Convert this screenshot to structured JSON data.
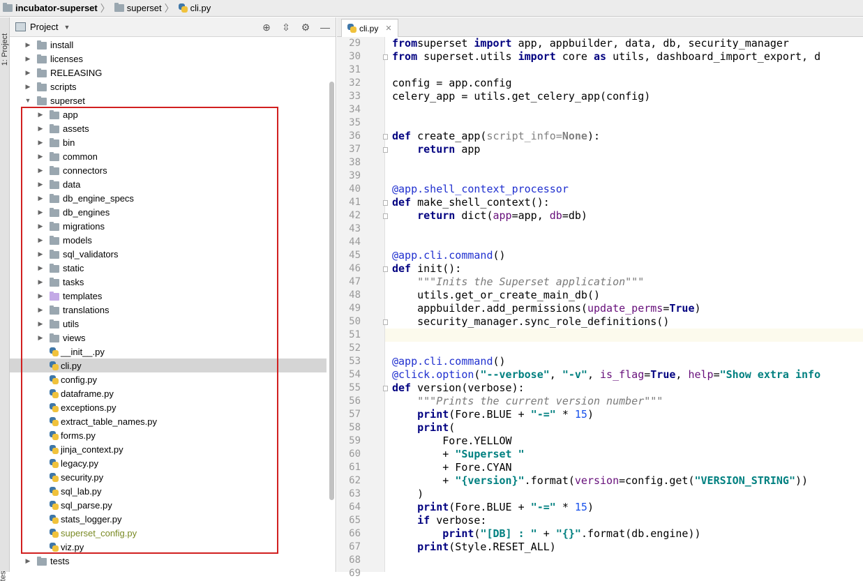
{
  "breadcrumb": {
    "project": "incubator-superset",
    "folder": "superset",
    "file": "cli.py"
  },
  "tool_strip": {
    "project_label": "1: Project",
    "bottom_label": "tes"
  },
  "project_panel": {
    "title": "Project",
    "tree": [
      {
        "label": "install",
        "type": "folder",
        "depth": 0,
        "expanded": false
      },
      {
        "label": "licenses",
        "type": "folder",
        "depth": 0,
        "expanded": false
      },
      {
        "label": "RELEASING",
        "type": "folder",
        "depth": 0,
        "expanded": false
      },
      {
        "label": "scripts",
        "type": "folder",
        "depth": 0,
        "expanded": false
      },
      {
        "label": "superset",
        "type": "folder",
        "depth": 0,
        "expanded": true
      },
      {
        "label": "app",
        "type": "folder",
        "depth": 1,
        "expanded": false
      },
      {
        "label": "assets",
        "type": "folder",
        "depth": 1,
        "expanded": false
      },
      {
        "label": "bin",
        "type": "folder",
        "depth": 1,
        "expanded": false
      },
      {
        "label": "common",
        "type": "folder",
        "depth": 1,
        "expanded": false
      },
      {
        "label": "connectors",
        "type": "folder",
        "depth": 1,
        "expanded": false
      },
      {
        "label": "data",
        "type": "folder",
        "depth": 1,
        "expanded": false
      },
      {
        "label": "db_engine_specs",
        "type": "folder",
        "depth": 1,
        "expanded": false
      },
      {
        "label": "db_engines",
        "type": "folder",
        "depth": 1,
        "expanded": false
      },
      {
        "label": "migrations",
        "type": "folder",
        "depth": 1,
        "expanded": false
      },
      {
        "label": "models",
        "type": "folder",
        "depth": 1,
        "expanded": false
      },
      {
        "label": "sql_validators",
        "type": "folder",
        "depth": 1,
        "expanded": false
      },
      {
        "label": "static",
        "type": "folder",
        "depth": 1,
        "expanded": false
      },
      {
        "label": "tasks",
        "type": "folder",
        "depth": 1,
        "expanded": false
      },
      {
        "label": "templates",
        "type": "folder-purple",
        "depth": 1,
        "expanded": false
      },
      {
        "label": "translations",
        "type": "folder",
        "depth": 1,
        "expanded": false
      },
      {
        "label": "utils",
        "type": "folder",
        "depth": 1,
        "expanded": false
      },
      {
        "label": "views",
        "type": "folder",
        "depth": 1,
        "expanded": false
      },
      {
        "label": "__init__.py",
        "type": "py",
        "depth": 1
      },
      {
        "label": "cli.py",
        "type": "py",
        "depth": 1,
        "selected": true
      },
      {
        "label": "config.py",
        "type": "py",
        "depth": 1
      },
      {
        "label": "dataframe.py",
        "type": "py",
        "depth": 1
      },
      {
        "label": "exceptions.py",
        "type": "py",
        "depth": 1
      },
      {
        "label": "extract_table_names.py",
        "type": "py",
        "depth": 1
      },
      {
        "label": "forms.py",
        "type": "py",
        "depth": 1
      },
      {
        "label": "jinja_context.py",
        "type": "py",
        "depth": 1
      },
      {
        "label": "legacy.py",
        "type": "py",
        "depth": 1
      },
      {
        "label": "security.py",
        "type": "py",
        "depth": 1
      },
      {
        "label": "sql_lab.py",
        "type": "py",
        "depth": 1
      },
      {
        "label": "sql_parse.py",
        "type": "py",
        "depth": 1
      },
      {
        "label": "stats_logger.py",
        "type": "py",
        "depth": 1
      },
      {
        "label": "superset_config.py",
        "type": "py",
        "depth": 1,
        "olive": true
      },
      {
        "label": "viz.py",
        "type": "py",
        "depth": 1
      },
      {
        "label": "tests",
        "type": "folder",
        "depth": 0,
        "expanded": false
      }
    ]
  },
  "editor": {
    "tab_label": "cli.py",
    "current_line": 51,
    "first_line": 29,
    "lines": [
      [
        [
          "kw",
          "from"
        ],
        [
          "",
          "superset"
        ],
        [
          "kw",
          " import"
        ],
        [
          "",
          " app, appbuilder, data, db, security_manager"
        ]
      ],
      [
        [
          "kw",
          "from"
        ],
        [
          "",
          " superset.utils "
        ],
        [
          "kw",
          "import"
        ],
        [
          "",
          " core "
        ],
        [
          "kw",
          "as"
        ],
        [
          "",
          " utils, dashboard_import_export, d"
        ]
      ],
      [],
      [
        [
          "",
          "config = app.config"
        ]
      ],
      [
        [
          "",
          "celery_app = utils.get_celery_app(config)"
        ]
      ],
      [],
      [],
      [
        [
          "kw",
          "def"
        ],
        [
          "",
          " create_app("
        ],
        [
          "gray",
          "script_info="
        ],
        [
          "gray bold",
          "None"
        ],
        [
          "",
          "):"
        ]
      ],
      [
        [
          "",
          "    "
        ],
        [
          "kw",
          "return"
        ],
        [
          "",
          " app"
        ]
      ],
      [],
      [],
      [
        [
          "dec",
          "@app.shell_context_processor"
        ]
      ],
      [
        [
          "kw",
          "def"
        ],
        [
          "",
          " make_shell_context():"
        ]
      ],
      [
        [
          "",
          "    "
        ],
        [
          "kw",
          "return"
        ],
        [
          "",
          " dict("
        ],
        [
          "param",
          "app"
        ],
        [
          "",
          "=app, "
        ],
        [
          "param",
          "db"
        ],
        [
          "",
          "=db)"
        ]
      ],
      [],
      [],
      [
        [
          "dec",
          "@app.cli.command"
        ],
        [
          "",
          "()"
        ]
      ],
      [
        [
          "kw",
          "def"
        ],
        [
          "",
          " init():"
        ]
      ],
      [
        [
          "",
          "    "
        ],
        [
          "doc",
          "\"\"\"Inits the Superset application\"\"\""
        ]
      ],
      [
        [
          "",
          "    utils.get_or_create_main_db()"
        ]
      ],
      [
        [
          "",
          "    appbuilder.add_permissions("
        ],
        [
          "param",
          "update_perms"
        ],
        [
          "",
          "="
        ],
        [
          "kw",
          "True"
        ],
        [
          "",
          ")"
        ]
      ],
      [
        [
          "",
          "    security_manager.sync_role_definitions()"
        ]
      ],
      [],
      [],
      [
        [
          "dec",
          "@app.cli.command"
        ],
        [
          "",
          "()"
        ]
      ],
      [
        [
          "dec",
          "@click.option"
        ],
        [
          "",
          "("
        ],
        [
          "str2",
          "\"--verbose\""
        ],
        [
          "",
          ", "
        ],
        [
          "str2",
          "\"-v\""
        ],
        [
          "",
          ", "
        ],
        [
          "param",
          "is_flag"
        ],
        [
          "",
          "="
        ],
        [
          "kw",
          "True"
        ],
        [
          "",
          ", "
        ],
        [
          "param",
          "help"
        ],
        [
          "",
          "="
        ],
        [
          "str2",
          "\"Show extra info"
        ]
      ],
      [
        [
          "kw",
          "def"
        ],
        [
          "",
          " version(verbose):"
        ]
      ],
      [
        [
          "",
          "    "
        ],
        [
          "doc",
          "\"\"\"Prints the current version number\"\"\""
        ]
      ],
      [
        [
          "",
          "    "
        ],
        [
          "kw",
          "print"
        ],
        [
          "",
          "(Fore.BLUE + "
        ],
        [
          "str2",
          "\"-=\""
        ],
        [
          "",
          " * "
        ],
        [
          "num",
          "15"
        ],
        [
          "",
          ")"
        ]
      ],
      [
        [
          "",
          "    "
        ],
        [
          "kw",
          "print"
        ],
        [
          "",
          "("
        ]
      ],
      [
        [
          "",
          "        Fore.YELLOW"
        ]
      ],
      [
        [
          "",
          "        + "
        ],
        [
          "str2",
          "\"Superset \""
        ]
      ],
      [
        [
          "",
          "        + Fore.CYAN"
        ]
      ],
      [
        [
          "",
          "        + "
        ],
        [
          "str2",
          "\"{version}\""
        ],
        [
          "",
          ".format("
        ],
        [
          "param",
          "version"
        ],
        [
          "",
          "=config.get("
        ],
        [
          "str2",
          "\"VERSION_STRING\""
        ],
        [
          "",
          "))"
        ]
      ],
      [
        [
          "",
          "    )"
        ]
      ],
      [
        [
          "",
          "    "
        ],
        [
          "kw",
          "print"
        ],
        [
          "",
          "(Fore.BLUE + "
        ],
        [
          "str2",
          "\"-=\""
        ],
        [
          "",
          " * "
        ],
        [
          "num",
          "15"
        ],
        [
          "",
          ")"
        ]
      ],
      [
        [
          "",
          "    "
        ],
        [
          "kw",
          "if"
        ],
        [
          "",
          " verbose:"
        ]
      ],
      [
        [
          "",
          "        "
        ],
        [
          "kw",
          "print"
        ],
        [
          "",
          "("
        ],
        [
          "str2",
          "\"[DB] : \""
        ],
        [
          "",
          " + "
        ],
        [
          "str2",
          "\"{}\""
        ],
        [
          "",
          ".format(db.engine))"
        ]
      ],
      [
        [
          "",
          "    "
        ],
        [
          "kw",
          "print"
        ],
        [
          "",
          "(Style.RESET_ALL)"
        ]
      ],
      [],
      []
    ]
  }
}
